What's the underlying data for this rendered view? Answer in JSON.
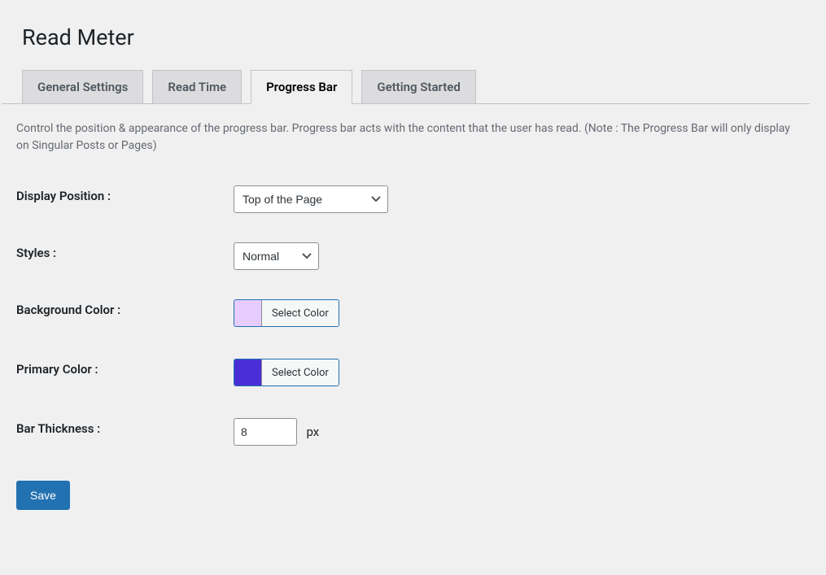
{
  "page": {
    "title": "Read Meter"
  },
  "tabs": [
    {
      "label": "General Settings",
      "active": false
    },
    {
      "label": "Read Time",
      "active": false
    },
    {
      "label": "Progress Bar",
      "active": true
    },
    {
      "label": "Getting Started",
      "active": false
    }
  ],
  "intro": "Control the position & appearance of the progress bar. Progress bar acts with the content that the user has read. (Note : The Progress Bar will only display on Singular Posts or Pages)",
  "fields": {
    "display_position": {
      "label": "Display Position :",
      "value": "Top of the Page"
    },
    "styles": {
      "label": "Styles :",
      "value": "Normal"
    },
    "background_color": {
      "label": "Background Color :",
      "button": "Select Color",
      "swatch": "#e6ccff"
    },
    "primary_color": {
      "label": "Primary Color :",
      "button": "Select Color",
      "swatch": "#4b2fd6"
    },
    "bar_thickness": {
      "label": "Bar Thickness :",
      "value": "8",
      "unit": "px"
    }
  },
  "actions": {
    "save": "Save"
  }
}
